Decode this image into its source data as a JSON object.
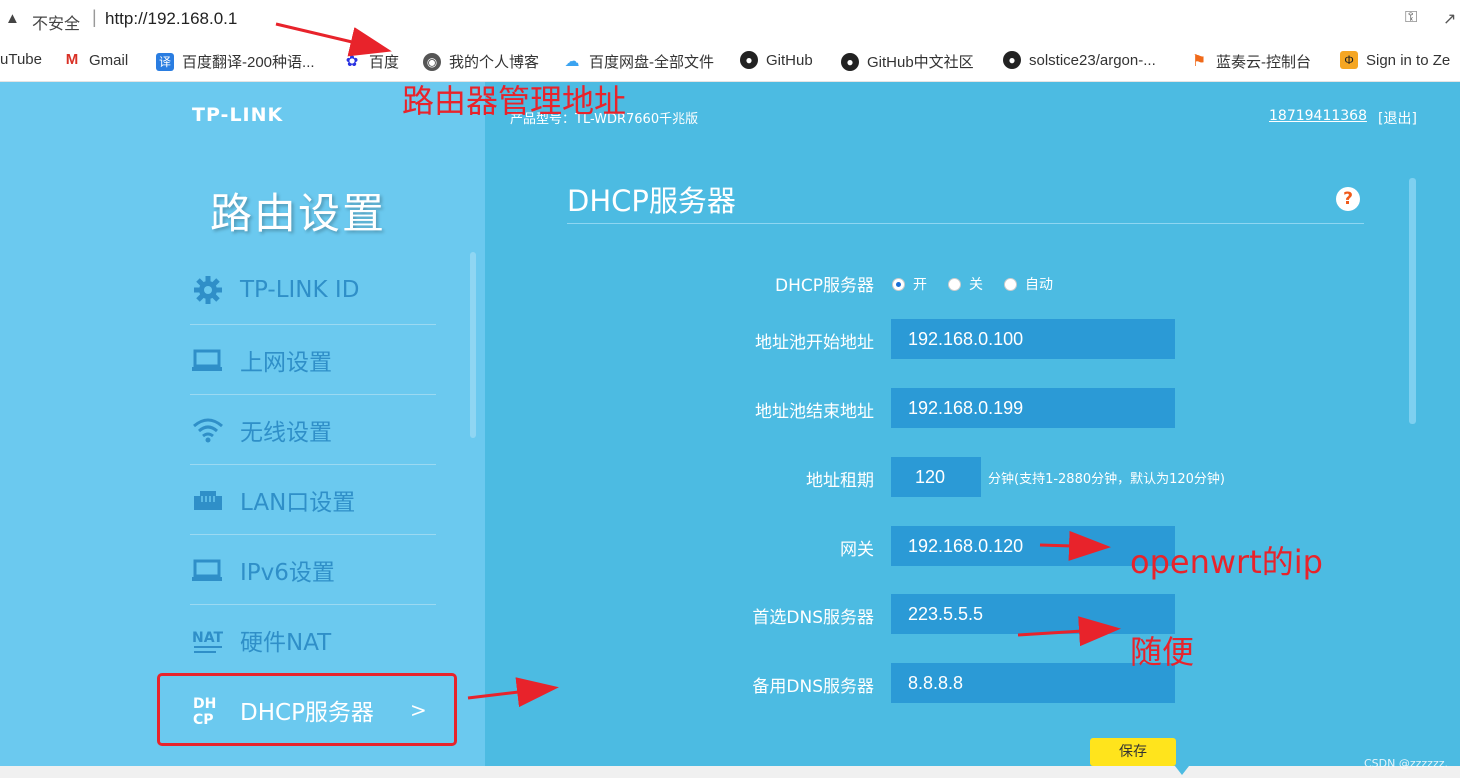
{
  "browser": {
    "warning_icon": "warning-triangle-icon",
    "insecure_label": "不安全",
    "separator": "|",
    "url": "http://192.168.0.1",
    "key_icon": "key-icon",
    "share_icon": "share-icon"
  },
  "bookmarks": [
    {
      "label": "uTube",
      "icon": "youtube-icon"
    },
    {
      "label": "Gmail",
      "icon": "gmail-icon"
    },
    {
      "label": "百度翻译-200种语...",
      "icon": "translate-icon"
    },
    {
      "label": "百度",
      "icon": "baidu-paw-icon"
    },
    {
      "label": "我的个人博客",
      "icon": "globe-icon"
    },
    {
      "label": "百度网盘-全部文件",
      "icon": "cloud-icon"
    },
    {
      "label": "GitHub",
      "icon": "github-icon"
    },
    {
      "label": "GitHub中文社区",
      "icon": "github-icon"
    },
    {
      "label": "solstice23/argon-...",
      "icon": "github-icon"
    },
    {
      "label": "蓝奏云-控制台",
      "icon": "flag-icon"
    },
    {
      "label": "Sign in to Ze",
      "icon": "zeabur-icon"
    }
  ],
  "router": {
    "logo": "TP-LINK",
    "model": "产品型号：TL-WDR7660千兆版",
    "user": "18719411368",
    "logout": "[退出]",
    "sidebar_title": "路由设置",
    "nav": [
      {
        "label": "TP-LINK ID",
        "icon": "gear-icon"
      },
      {
        "label": "上网设置",
        "icon": "monitor-icon"
      },
      {
        "label": "无线设置",
        "icon": "wifi-icon"
      },
      {
        "label": "LAN口设置",
        "icon": "lan-port-icon"
      },
      {
        "label": "IPv6设置",
        "icon": "monitor-icon"
      },
      {
        "label": "硬件NAT",
        "icon": "nat-icon"
      },
      {
        "label": "DHCP服务器",
        "icon": "dhcp-icon",
        "active": true,
        "chevron": ">"
      }
    ],
    "page_title": "DHCP服务器",
    "help": "?",
    "form": {
      "dhcp_label": "DHCP服务器",
      "radio_on": "开",
      "radio_off": "关",
      "radio_auto": "自动",
      "selected": "开",
      "pool_start_label": "地址池开始地址",
      "pool_start": "192.168.0.100",
      "pool_end_label": "地址池结束地址",
      "pool_end": "192.168.0.199",
      "lease_label": "地址租期",
      "lease": "120",
      "lease_note": "分钟(支持1-2880分钟，默认为120分钟)",
      "gateway_label": "网关",
      "gateway": "192.168.0.120",
      "dns1_label": "首选DNS服务器",
      "dns1": "223.5.5.5",
      "dns2_label": "备用DNS服务器",
      "dns2": "8.8.8.8",
      "save": "保存"
    },
    "watermark": "CSDN @zzzzzz."
  },
  "annotations": {
    "router_addr": "路由器管理地址",
    "openwrt": "openwrt的ip",
    "any": "随便",
    "color": "#e8232b"
  }
}
